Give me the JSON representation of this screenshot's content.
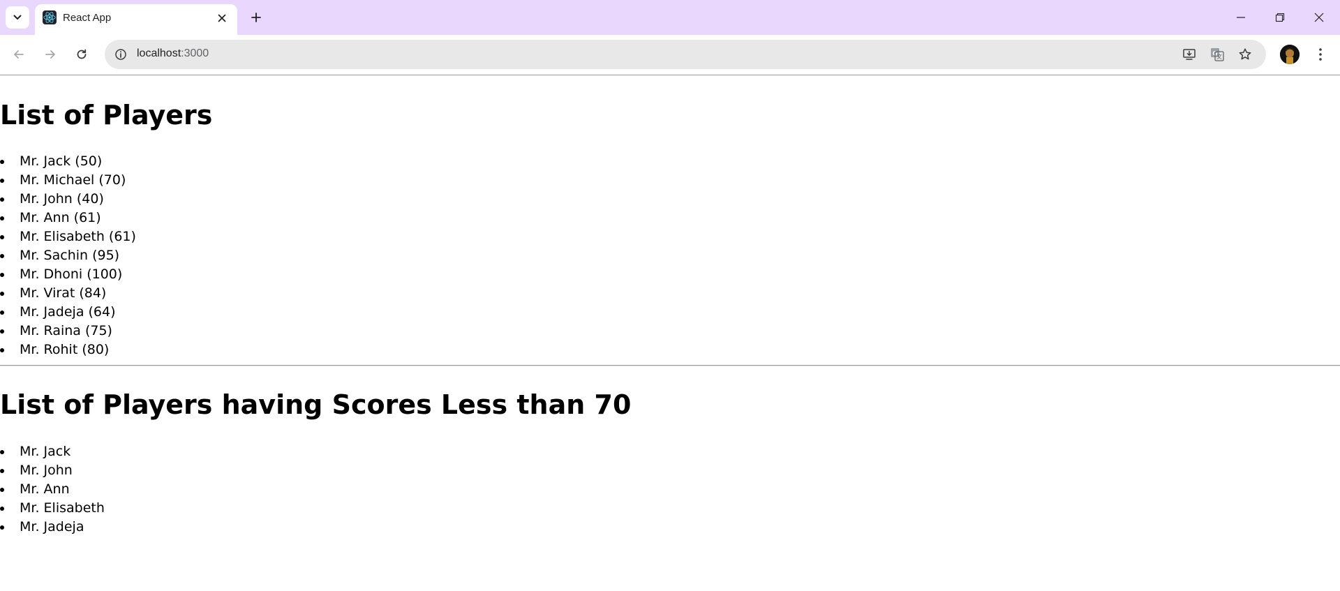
{
  "browser": {
    "tab": {
      "title": "React App"
    },
    "address": {
      "host": "localhost",
      "port": ":3000"
    }
  },
  "icons": {
    "tab_search": "chevron-down-icon",
    "favicon": "react-logo-icon",
    "tab_close": "close-icon",
    "new_tab": "plus-icon",
    "back": "arrow-left-icon",
    "forward": "arrow-right-icon",
    "reload": "reload-icon",
    "site_info": "info-icon",
    "install": "install-app-icon",
    "translate": "translate-icon",
    "bookmark": "star-icon",
    "profile": "avatar",
    "menu": "more-vertical-icon",
    "minimize": "minimize-icon",
    "restore": "restore-icon",
    "close_window": "close-icon"
  },
  "colors": {
    "tabbar_bg": "#e9d7fd",
    "omnibox_bg": "#e8e8e8"
  },
  "content": {
    "heading_all": "List of Players",
    "players": [
      "Mr. Jack (50)",
      "Mr. Michael (70)",
      "Mr. John (40)",
      "Mr. Ann (61)",
      "Mr. Elisabeth (61)",
      "Mr. Sachin (95)",
      "Mr. Dhoni (100)",
      "Mr. Virat (84)",
      "Mr. Jadeja (64)",
      "Mr. Raina (75)",
      "Mr. Rohit (80)"
    ],
    "heading_filtered": "List of Players having Scores Less than 70",
    "filtered_players": [
      "Mr. Jack",
      "Mr. John",
      "Mr. Ann",
      "Mr. Elisabeth",
      "Mr. Jadeja"
    ]
  }
}
